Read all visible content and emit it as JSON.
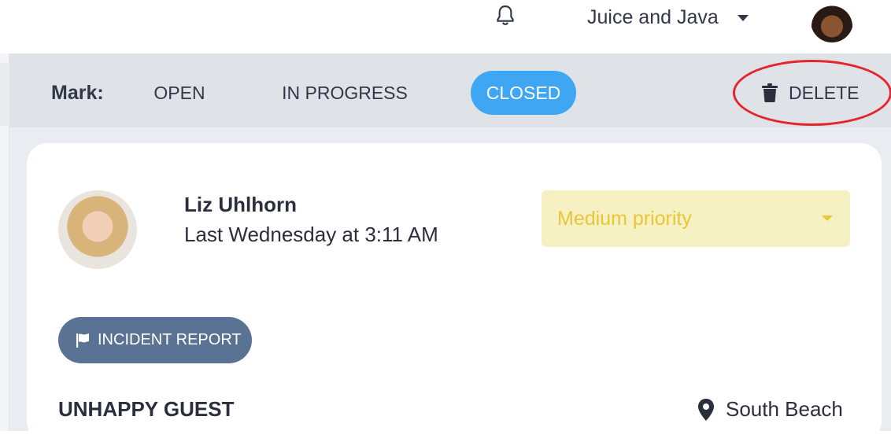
{
  "topbar": {
    "organization": "Juice and Java"
  },
  "actions": {
    "mark_label": "Mark:",
    "statuses": [
      "OPEN",
      "IN PROGRESS",
      "CLOSED"
    ],
    "active_status": "CLOSED",
    "delete_label": "DELETE"
  },
  "ticket": {
    "reporter_name": "Liz Uhlhorn",
    "timestamp": "Last Wednesday at 3:11 AM",
    "priority": "Medium priority",
    "category": "INCIDENT REPORT",
    "title": "UNHAPPY GUEST",
    "location": "South Beach"
  },
  "colors": {
    "accent": "#3ea6f2",
    "priority_bg": "#f6f1c3",
    "priority_text": "#e9c538",
    "tag_bg": "#5a7394",
    "annotation_red": "#e4262c"
  },
  "icons": [
    "bell-icon",
    "caret-down-icon",
    "trash-icon",
    "flag-icon",
    "map-pin-icon"
  ]
}
